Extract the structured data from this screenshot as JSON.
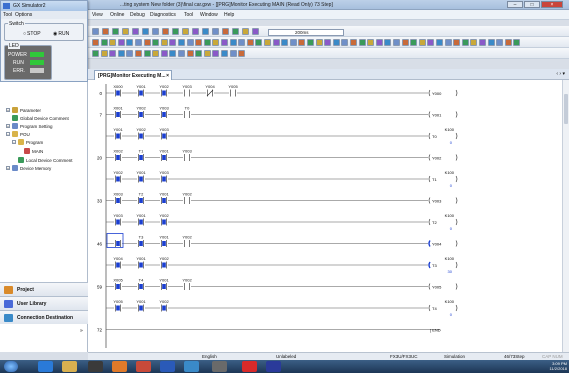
{
  "window": {
    "title": "...ting system New folder (3)\\final car.gxw - [[PRG]Monitor Executing MAIN (Read Only) 73 Step]"
  },
  "menu": [
    "View",
    "Online",
    "Debug",
    "Diagnostics",
    "Tool",
    "Window",
    "Help"
  ],
  "toolbar": {
    "timing": "200ms"
  },
  "simulator": {
    "title": "GX Simulator2",
    "menu": [
      "Tool",
      "Options"
    ],
    "switch_label": "Switch",
    "stop": "STOP",
    "run": "RUN",
    "led_label": "LED",
    "leds": [
      "POWER",
      "RUN",
      "ERR."
    ]
  },
  "nav": {
    "items": [
      "Parameter",
      "Global Device Comment",
      "Program Setting",
      "POU",
      "Program",
      "MAIN",
      "Local Device Comment",
      "Device Memory"
    ],
    "buttons": [
      "Project",
      "User Library",
      "Connection Destination"
    ]
  },
  "tab": {
    "label": "[PRG]Monitor Executing M...",
    "close": "×",
    "arrows": "‹ › ▾"
  },
  "rungs": [
    {
      "step": "0",
      "contacts": [
        "X000",
        "Y001",
        "Y002",
        "Y003",
        "Y004",
        "Y005"
      ],
      "coil": "Y000",
      "kval": "",
      "cur": ""
    },
    {
      "step": "7",
      "contacts": [
        "X001",
        "Y002",
        "Y003",
        "T0"
      ],
      "coil": "Y001",
      "kval": "",
      "cur": ""
    },
    {
      "step": "",
      "contacts": [
        "Y001",
        "Y002",
        "Y003"
      ],
      "coil": "T0",
      "kval": "K100",
      "cur": "0"
    },
    {
      "step": "20",
      "contacts": [
        "X002",
        "T1",
        "Y001",
        "Y003"
      ],
      "coil": "Y002",
      "kval": "",
      "cur": ""
    },
    {
      "step": "",
      "contacts": [
        "Y002",
        "Y001",
        "Y003"
      ],
      "coil": "T1",
      "kval": "K100",
      "cur": "0"
    },
    {
      "step": "33",
      "contacts": [
        "X003",
        "T2",
        "Y001",
        "Y002"
      ],
      "coil": "Y003",
      "kval": "",
      "cur": ""
    },
    {
      "step": "",
      "contacts": [
        "Y003",
        "Y001",
        "Y002"
      ],
      "coil": "T2",
      "kval": "K100",
      "cur": "0"
    },
    {
      "step": "46",
      "contacts": [
        "X004",
        "T3",
        "Y001",
        "Y002"
      ],
      "coil": "Y004",
      "kval": "",
      "cur": ""
    },
    {
      "step": "",
      "contacts": [
        "Y004",
        "Y001",
        "Y002"
      ],
      "coil": "T3",
      "kval": "K100",
      "cur": "30"
    },
    {
      "step": "59",
      "contacts": [
        "X005",
        "T4",
        "Y001",
        "Y002"
      ],
      "coil": "Y005",
      "kval": "",
      "cur": ""
    },
    {
      "step": "",
      "contacts": [
        "Y005",
        "Y001",
        "Y002"
      ],
      "coil": "T4",
      "kval": "K100",
      "cur": "0"
    },
    {
      "step": "72",
      "contacts": [],
      "coil": "END",
      "kval": "",
      "cur": ""
    }
  ],
  "status": {
    "lang": "English",
    "label": "Unlabeled",
    "cpu": "FX3U/FX3UC",
    "mode": "Simulation",
    "steps": "46/73Step",
    "cap": "CAP NUM"
  },
  "tray": {
    "time": "3:09 PM",
    "date": "11/2/2018"
  }
}
